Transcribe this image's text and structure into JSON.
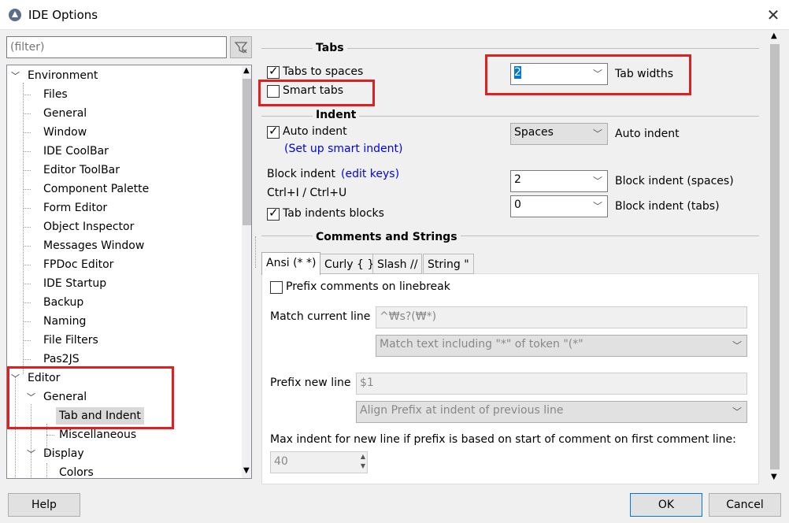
{
  "window": {
    "title": "IDE Options",
    "close_icon": "close-icon"
  },
  "filter": {
    "placeholder": "(filter)",
    "icon": "filter-clear-icon"
  },
  "tree": {
    "items": [
      "Environment",
      "Files",
      "General",
      "Window",
      "IDE CoolBar",
      "Editor ToolBar",
      "Component Palette",
      "Form Editor",
      "Object Inspector",
      "Messages Window",
      "FPDoc Editor",
      "IDE Startup",
      "Backup",
      "Naming",
      "File Filters",
      "Pas2JS",
      "Editor",
      "General",
      "Tab and Indent",
      "Miscellaneous",
      "Display",
      "Colors"
    ],
    "selected": "Tab and Indent"
  },
  "tabs_section": {
    "title": "Tabs",
    "tabs_to_spaces": "Tabs to spaces",
    "smart_tabs": "Smart tabs",
    "tab_widths_value": "2",
    "tab_widths_label": "Tab widths"
  },
  "indent_section": {
    "title": "Indent",
    "auto_indent": "Auto indent",
    "setup_smart_indent": "(Set up smart indent)",
    "auto_indent_combo": "Spaces",
    "auto_indent_label": "Auto indent",
    "block_indent": "Block indent",
    "edit_keys": "(edit keys)",
    "ctrl_keys": "Ctrl+I / Ctrl+U",
    "tab_indents_blocks": "Tab indents blocks",
    "block_indent_spaces_value": "2",
    "block_indent_spaces_label": "Block indent (spaces)",
    "block_indent_tabs_value": "0",
    "block_indent_tabs_label": "Block indent (tabs)"
  },
  "comments_section": {
    "title": "Comments and Strings",
    "tabs": [
      "Ansi (* *)",
      "Curly { }",
      "Slash //",
      "String \""
    ],
    "prefix_on_linebreak": "Prefix comments on linebreak",
    "match_current_line": "Match current line",
    "match_value": "^₩s?(₩*)",
    "match_mode": "Match text including \"*\" of token \"(*\"",
    "prefix_new_line": "Prefix new line",
    "prefix_value": "$1",
    "align_mode": "Align Prefix at indent of previous line",
    "max_indent_label": "Max indent for new line if prefix is based on start of comment on first comment line:",
    "max_indent_value": "40"
  },
  "buttons": {
    "help": "Help",
    "ok": "OK",
    "cancel": "Cancel"
  },
  "colors": {
    "highlight_box": "#e02020",
    "link": "#0000ee",
    "selection": "#d9d9d9"
  }
}
